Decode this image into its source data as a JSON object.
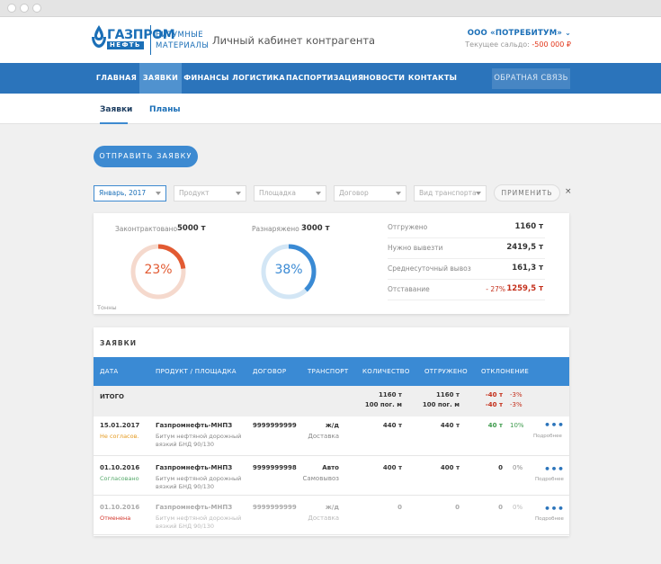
{
  "header": {
    "logo_word1": "ГАЗПРОМ",
    "logo_word2": "НЕФТЬ",
    "logo_sub_line1": "БИТУМНЫЕ",
    "logo_sub_line2": "МАТЕРИАЛЫ",
    "page_title": "Личный кабинет контрагента",
    "company": "ООО «ПОТРЕБИТУМ»",
    "balance_label": "Текущее сальдо:",
    "balance_value": "-500 000 ₽"
  },
  "nav": {
    "items": [
      "ГЛАВНАЯ",
      "ЗАЯВКИ",
      "ФИНАНСЫ",
      "ЛОГИСТИКА",
      "ПАСПОРТИЗАЦИЯ",
      "НОВОСТИ",
      "КОНТАКТЫ"
    ],
    "feedback": "ОБРАТНАЯ СВЯЗЬ"
  },
  "subtabs": [
    "Заявки",
    "Планы"
  ],
  "send_button": "ОТПРАВИТЬ ЗАЯВКУ",
  "filters": {
    "period": "Январь, 2017",
    "product_placeholder": "Продукт",
    "site_placeholder": "Площадка",
    "contract_placeholder": "Договор",
    "transport_placeholder": "Вид транспорта",
    "apply": "ПРИМЕНИТЬ",
    "clear": "×"
  },
  "stats": {
    "contracted_label": "Законтрактовано",
    "contracted_value": "5000 т",
    "contracted_pct": "23%",
    "contracted_fraction": 0.23,
    "allocated_label": "Разнаряжено",
    "allocated_value": "3000 т",
    "allocated_pct": "38%",
    "allocated_fraction": 0.38,
    "units": "Тонны",
    "shipped_label": "Отгружено",
    "shipped_value": "1160 т",
    "to_ship_label": "Нужно вывезти",
    "to_ship_value": "2419,5 т",
    "daily_label": "Среднесуточный вывоз",
    "daily_value": "161,3 т",
    "lag_label": "Отставание",
    "lag_pct": "- 27%",
    "lag_value": "1259,5 т",
    "colors": {
      "contracted": "#e25a32",
      "allocated": "#3a8ad4",
      "negative": "#c4301c"
    }
  },
  "orders": {
    "title": "ЗАЯВКИ",
    "columns": [
      "ДАТА",
      "ПРОДУКТ / ПЛОЩАДКА",
      "ДОГОВОР",
      "ТРАНСПОРТ",
      "КОЛИЧЕСТВО",
      "ОТГРУЖЕНО",
      "ОТКЛОНЕНИЕ"
    ],
    "total": {
      "label": "ИТОГО",
      "qty_t": "1160 т",
      "qty_m": "100 пог. м",
      "shipped_t": "1160 т",
      "shipped_m": "100 пог. м",
      "dev1": "-40 т",
      "dev1_pct": "-3%",
      "dev2": "-40 т",
      "dev2_pct": "-3%"
    },
    "more_label": "Подробнее",
    "rows": [
      {
        "date": "15.01.2017",
        "status": "Не согласов.",
        "site": "Газпромнефть-МНПЗ",
        "product": "Битум нефтяной дорожный",
        "product2": "вязкий БНД 90/130",
        "contract": "9999999999",
        "transport": "ж/д",
        "delivery": "Доставка",
        "qty": "440 т",
        "shipped": "440 т",
        "dev": "40 т",
        "dev_pct": "10%"
      },
      {
        "date": "01.10.2016",
        "status": "Согласовано",
        "site": "Газпромнефть-МНПЗ",
        "product": "Битум нефтяной дорожный",
        "product2": "вязкий БНД 90/130",
        "contract": "9999999998",
        "transport": "Авто",
        "delivery": "Самовывоз",
        "qty": "400 т",
        "shipped": "400 т",
        "dev": "0",
        "dev_pct": "0%"
      },
      {
        "date": "01.10.2016",
        "status": "Отменена",
        "site": "Газпромнефть-МНПЗ",
        "product": "Битум нефтяной дорожный",
        "product2": "вязкий БНД 90/130",
        "contract": "9999999999",
        "transport": "ж/д",
        "delivery": "Доставка",
        "qty": "0",
        "shipped": "0",
        "dev": "0",
        "dev_pct": "0%"
      }
    ]
  }
}
